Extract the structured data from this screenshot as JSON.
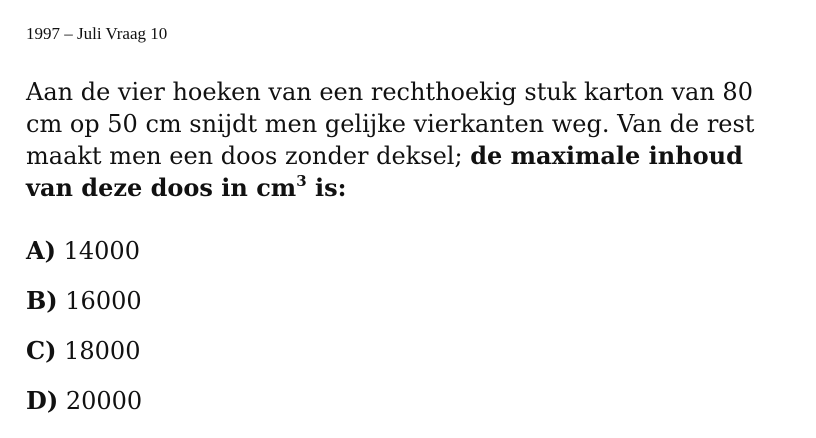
{
  "header": {
    "title": "1997 – Juli Vraag 10"
  },
  "question": {
    "text_regular": "Aan de vier hoeken van een rechthoekig stuk karton van 80 cm op 50 cm snijdt men gelijke vierkanten weg. Van de rest maakt men een doos zonder deksel; ",
    "text_bold": "de maximale inhoud van deze doos in cm",
    "superscript": "3",
    "text_bold_end": " is:"
  },
  "options": [
    {
      "letter": "A)",
      "value": "14000"
    },
    {
      "letter": "B)",
      "value": "16000"
    },
    {
      "letter": "C)",
      "value": "18000"
    },
    {
      "letter": "D)",
      "value": "20000"
    }
  ]
}
